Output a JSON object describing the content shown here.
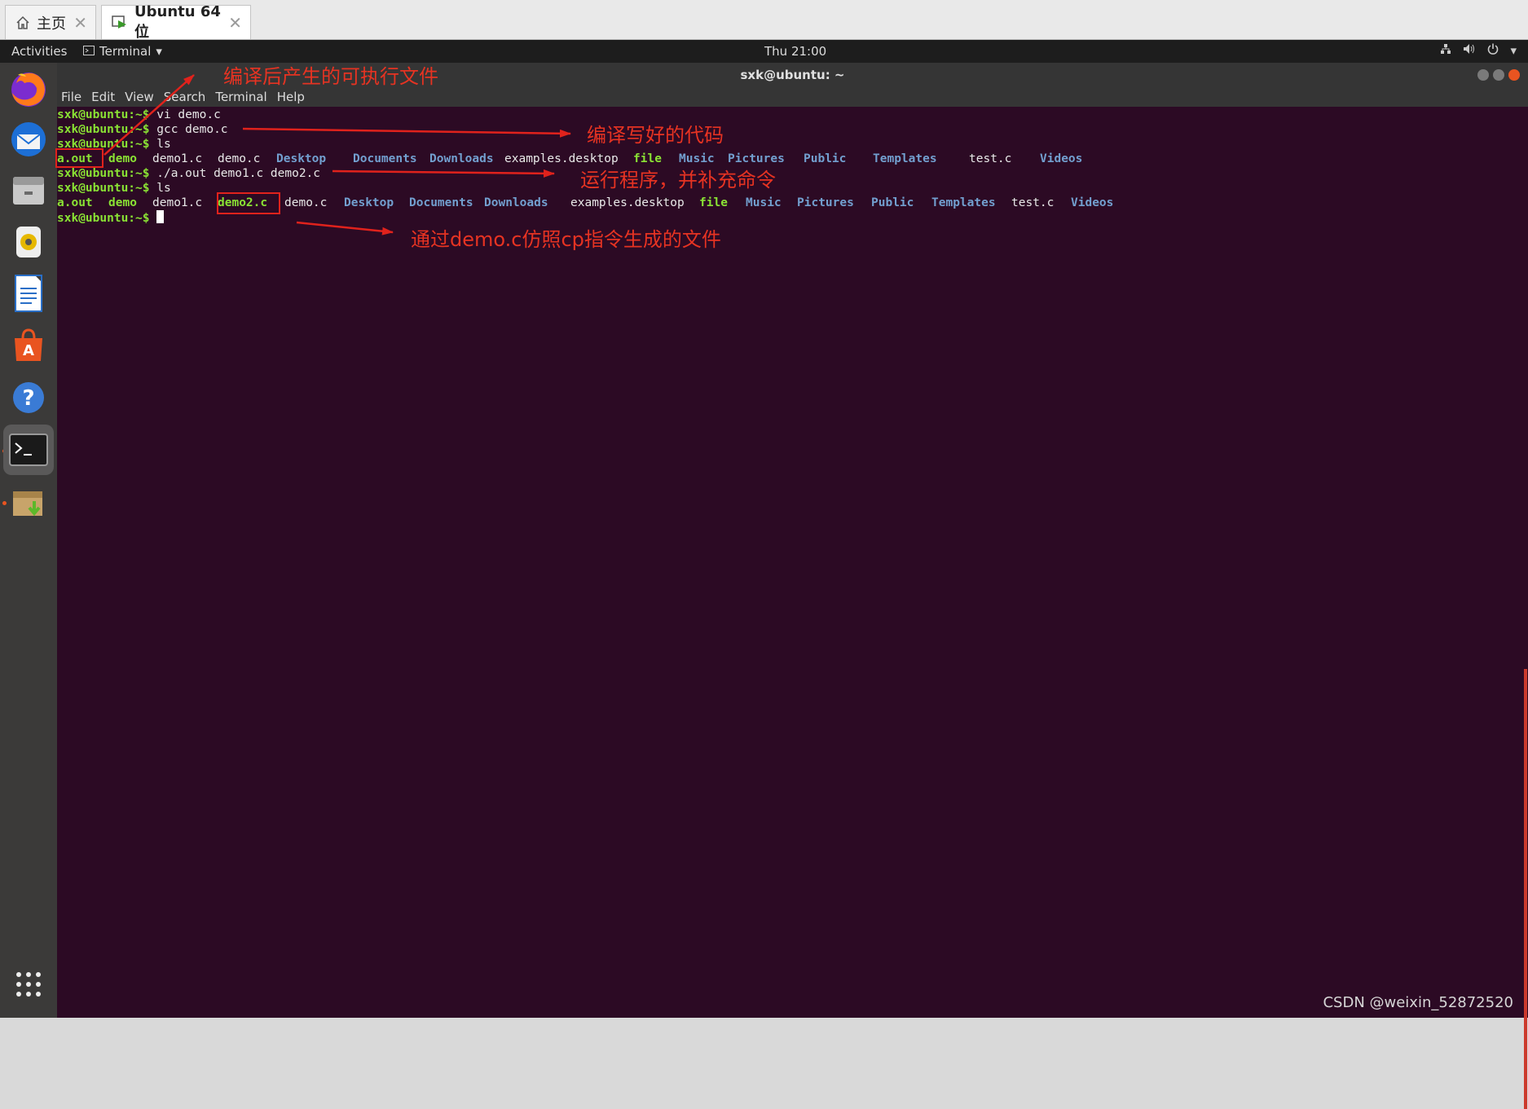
{
  "vm_tabs": [
    {
      "label": "主页",
      "icon": "home-icon"
    },
    {
      "label": "Ubuntu 64 位",
      "icon": "vm-icon"
    }
  ],
  "topbar": {
    "activities": "Activities",
    "app_menu": "Terminal",
    "clock": "Thu 21:00"
  },
  "window": {
    "title": "sxk@ubuntu: ~"
  },
  "menu": [
    "File",
    "Edit",
    "View",
    "Search",
    "Terminal",
    "Help"
  ],
  "terminal": {
    "prompt": "sxk@ubuntu:~$",
    "commands": {
      "vi": " vi demo.c",
      "gcc": " gcc demo.c",
      "ls1": " ls",
      "run": " ./a.out demo1.c demo2.c",
      "ls2": " ls",
      "last": " "
    },
    "ls1_items": [
      {
        "name": "a.out",
        "kind": "exe"
      },
      {
        "name": "demo",
        "kind": "exe"
      },
      {
        "name": "demo1.c",
        "kind": "file"
      },
      {
        "name": "demo.c",
        "kind": "file"
      },
      {
        "name": "Desktop",
        "kind": "dir"
      },
      {
        "name": "Documents",
        "kind": "dir"
      },
      {
        "name": "Downloads",
        "kind": "dir"
      },
      {
        "name": "examples.desktop",
        "kind": "file"
      },
      {
        "name": "file",
        "kind": "exe"
      },
      {
        "name": "Music",
        "kind": "dir"
      },
      {
        "name": "Pictures",
        "kind": "dir"
      },
      {
        "name": "Public",
        "kind": "dir"
      },
      {
        "name": "Templates",
        "kind": "dir"
      },
      {
        "name": "test.c",
        "kind": "file"
      },
      {
        "name": "Videos",
        "kind": "dir"
      }
    ],
    "ls2_items": [
      {
        "name": "a.out",
        "kind": "exe"
      },
      {
        "name": "demo",
        "kind": "exe"
      },
      {
        "name": "demo1.c",
        "kind": "file"
      },
      {
        "name": "demo2.c",
        "kind": "exe"
      },
      {
        "name": "demo.c",
        "kind": "file"
      },
      {
        "name": "Desktop",
        "kind": "dir"
      },
      {
        "name": "Documents",
        "kind": "dir"
      },
      {
        "name": "Downloads",
        "kind": "dir"
      },
      {
        "name": "examples.desktop",
        "kind": "file"
      },
      {
        "name": "file",
        "kind": "exe"
      },
      {
        "name": "Music",
        "kind": "dir"
      },
      {
        "name": "Pictures",
        "kind": "dir"
      },
      {
        "name": "Public",
        "kind": "dir"
      },
      {
        "name": "Templates",
        "kind": "dir"
      },
      {
        "name": "test.c",
        "kind": "file"
      },
      {
        "name": "Videos",
        "kind": "dir"
      }
    ]
  },
  "annotations": {
    "executable": "编译后产生的可执行文件",
    "compile": "编译写好的代码",
    "run": "运行程序，并补充命令",
    "generated": "通过demo.c仿照cp指令生成的文件"
  },
  "watermark": "CSDN @weixin_52872520",
  "colors": {
    "terminal_bg": "#2c0a24",
    "prompt": "#8ae234",
    "directory": "#729fcf",
    "annotation": "#e63322"
  }
}
